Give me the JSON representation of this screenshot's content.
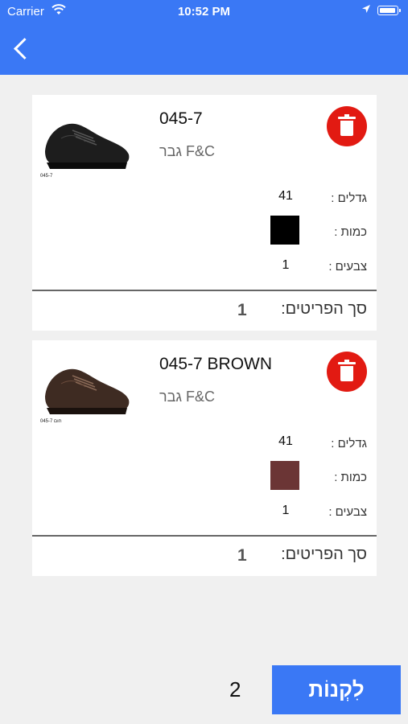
{
  "status_bar": {
    "carrier": "Carrier",
    "time": "10:52 PM"
  },
  "cart": {
    "items": [
      {
        "model": "045-7",
        "brand": "גבר F&C",
        "image_caption": "045-7",
        "sizes_label": "גדלים :",
        "sizes_value": "41",
        "quantity_label": "כמות :",
        "color_swatch": "#000000",
        "colors_label": "צבעים :",
        "colors_value": "1",
        "total_label": "סך הפריטים:",
        "total_value": "1"
      },
      {
        "model": "045-7 BROWN",
        "brand": "גבר F&C",
        "image_caption": "045-7 חום",
        "sizes_label": "גדלים :",
        "sizes_value": "41",
        "quantity_label": "כמות :",
        "color_swatch": "#6b3535",
        "colors_label": "צבעים :",
        "colors_value": "1",
        "total_label": "סך הפריטים:",
        "total_value": "1"
      }
    ],
    "total_count": "2",
    "buy_label": "לִקְנוֹת"
  },
  "colors": {
    "accent": "#3a78f5",
    "delete": "#e21a12"
  }
}
